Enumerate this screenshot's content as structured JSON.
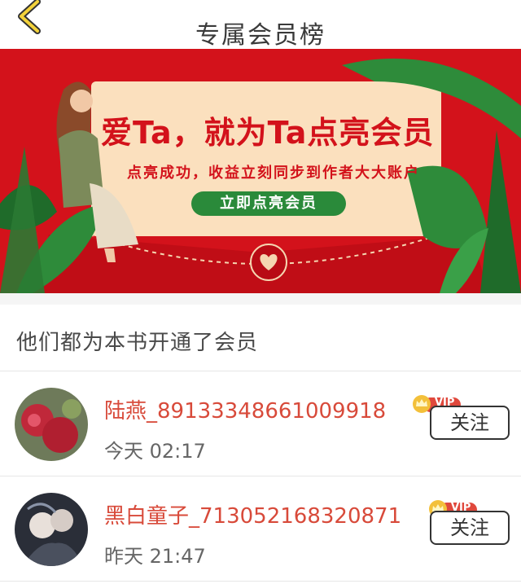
{
  "header": {
    "title": "专属会员榜"
  },
  "banner": {
    "headline": "爱Ta，就为Ta点亮会员",
    "subline": "点亮成功，收益立刻同步到作者大大账户",
    "cta": "立即点亮会员"
  },
  "section": {
    "title": "他们都为本书开通了会员"
  },
  "members": [
    {
      "name": "陆燕_89133348661009918",
      "time": "今天 02:17",
      "badge": "VIP",
      "follow": "关注"
    },
    {
      "name": "黑白童子_713052168320871",
      "time": "昨天 21:47",
      "badge": "VIP",
      "follow": "关注"
    }
  ],
  "colors": {
    "brand_red": "#d3121b",
    "name_red": "#d84a3a",
    "vip_gold": "#f3c03a",
    "cta_green": "#2a8a3a"
  }
}
